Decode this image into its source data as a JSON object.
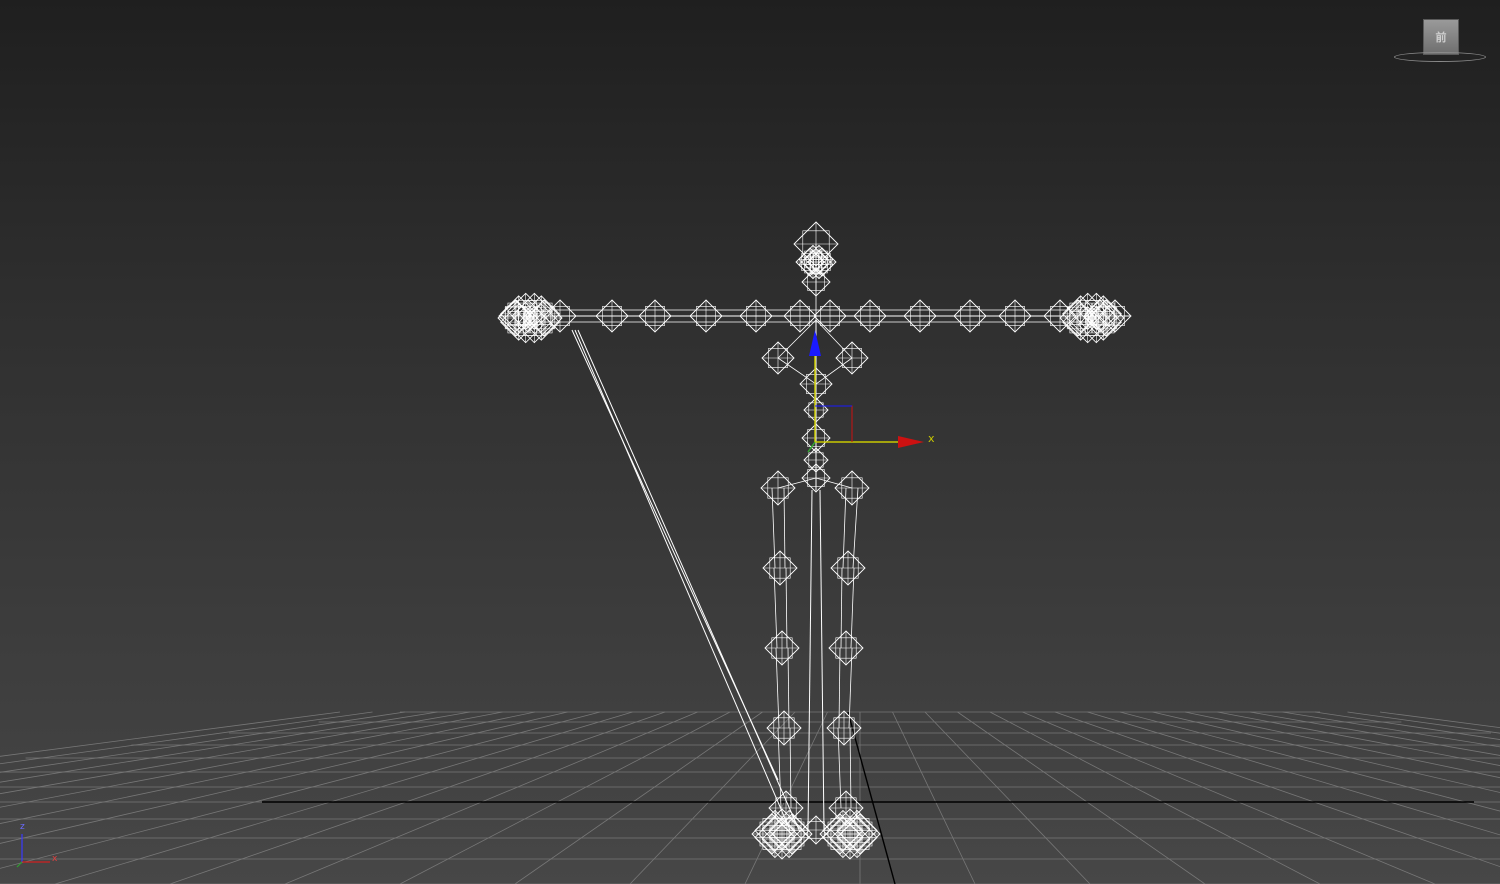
{
  "viewport": {
    "background_top": "#1f1f1f",
    "background_bottom": "#474747",
    "grid_color": "#777777",
    "grid_axis_color": "#000000",
    "wireframe_color": "#ffffff"
  },
  "gizmo": {
    "x_label": "x",
    "x_color": "#c8c800",
    "x_arrow_color": "#cc1111",
    "z_color": "#1a1aff",
    "y_color": "#33aa33"
  },
  "viewcube": {
    "face_label": "前",
    "icon": "viewcube-icon"
  },
  "axis_tripod": {
    "z_label": "z",
    "x_label": "x",
    "z_color": "#3a3aff",
    "x_color": "#d02020",
    "y_color": "#30a030"
  }
}
